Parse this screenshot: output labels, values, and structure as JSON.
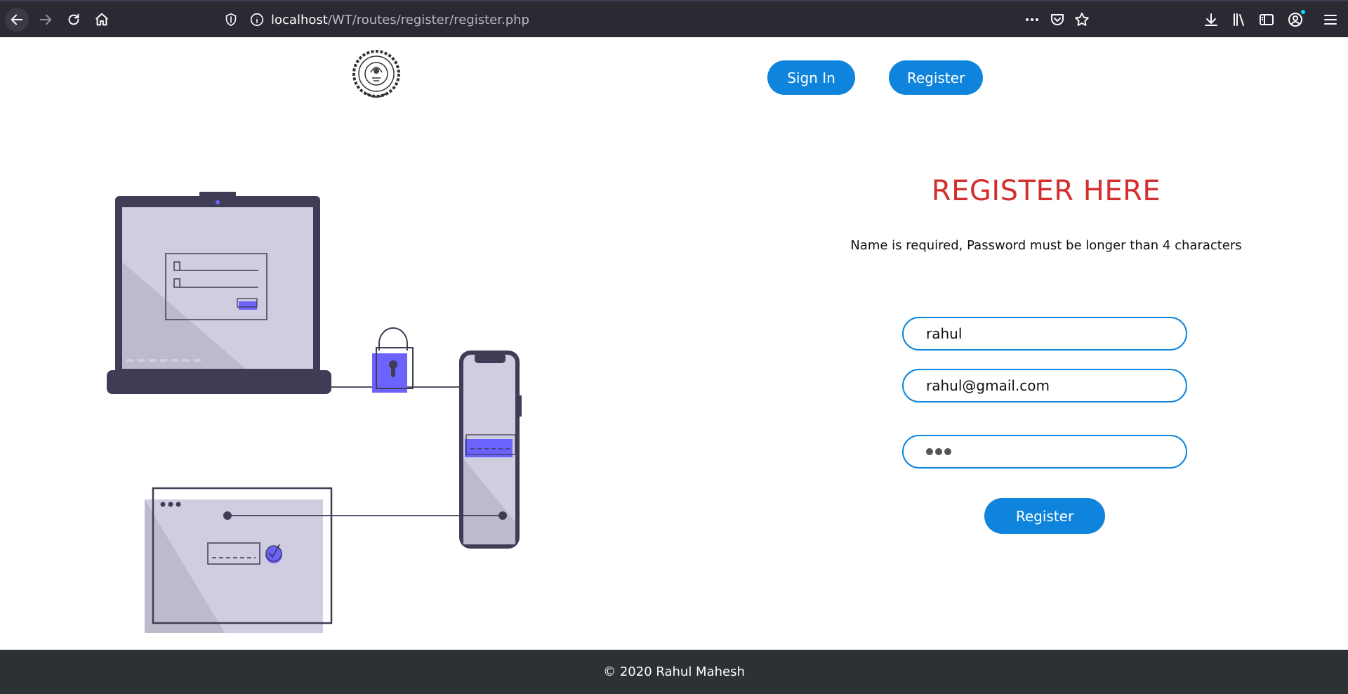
{
  "browser": {
    "url_host": "localhost",
    "url_path": "/WT/routes/register/register.php"
  },
  "nav": {
    "signin_label": "Sign In",
    "register_label": "Register"
  },
  "form": {
    "title": "REGISTER HERE",
    "hint": "Name is required, Password must be longer than 4 characters",
    "name_value": "rahul",
    "email_value": "rahul@gmail.com",
    "password_length": 3,
    "submit_label": "Register"
  },
  "footer": {
    "text": "© 2020 Rahul Mahesh"
  },
  "colors": {
    "accent": "#0e84dd",
    "title": "#d32f2f",
    "footer_bg": "#2b3134",
    "illustration_purple": "#6c63ff"
  },
  "icons": [
    "back-icon",
    "forward-icon",
    "reload-icon",
    "home-icon",
    "shield-icon",
    "info-icon",
    "more-icon",
    "pocket-icon",
    "star-icon",
    "download-icon",
    "library-icon",
    "sidebar-icon",
    "account-icon",
    "menu-icon"
  ]
}
